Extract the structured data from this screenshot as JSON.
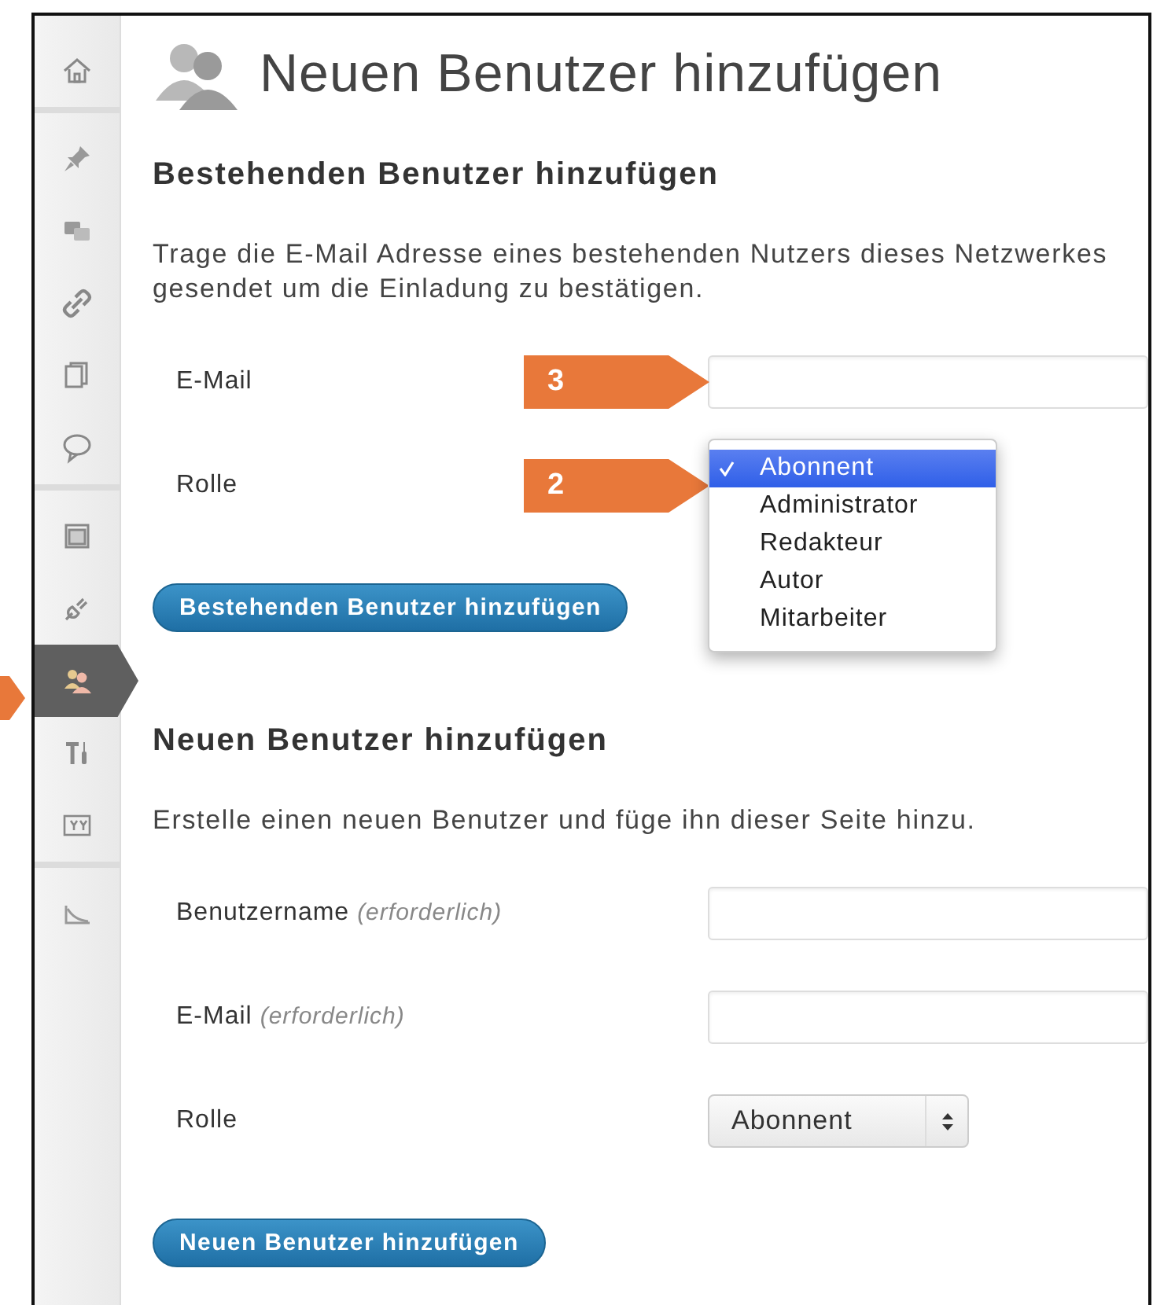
{
  "sidebar": {
    "items": [
      {
        "selected": false
      },
      {
        "selected": false
      },
      {
        "selected": false
      },
      {
        "selected": false
      },
      {
        "selected": false
      },
      {
        "selected": false
      },
      {
        "selected": false
      },
      {
        "selected": false
      },
      {
        "selected": true
      },
      {
        "selected": false
      },
      {
        "selected": false
      },
      {
        "selected": false
      }
    ]
  },
  "page_title": "Neuen Benutzer hinzufügen",
  "existing_user": {
    "heading": "Bestehenden Benutzer hinzufügen",
    "description": "Trage die E-Mail Adresse eines bestehenden Nutzers dieses Netzwerkes\ngesendet um die Einladung zu bestätigen.",
    "fields": [
      {
        "kind": "input",
        "label": "E-Mail",
        "callout": "3"
      },
      {
        "kind": "dropdown",
        "label": "Rolle",
        "callout": "2",
        "options": [
          {
            "label": "Abonnent",
            "selected": true
          },
          {
            "label": "Administrator",
            "selected": false
          },
          {
            "label": "Redakteur",
            "selected": false
          },
          {
            "label": "Autor",
            "selected": false
          },
          {
            "label": "Mitarbeiter",
            "selected": false
          }
        ]
      }
    ],
    "button": "Bestehenden Benutzer hinzufügen"
  },
  "new_user": {
    "heading": "Neuen Benutzer hinzufügen",
    "description": "Erstelle einen neuen Benutzer und füge ihn dieser Seite hinzu.",
    "fields": [
      {
        "kind": "input",
        "label": "Benutzername",
        "hint": "(erforderlich)"
      },
      {
        "kind": "input",
        "label": "E-Mail",
        "hint": "(erforderlich)"
      },
      {
        "kind": "select",
        "label": "Rolle",
        "value": "Abonnent"
      }
    ],
    "button": "Neuen Benutzer hinzufügen"
  }
}
